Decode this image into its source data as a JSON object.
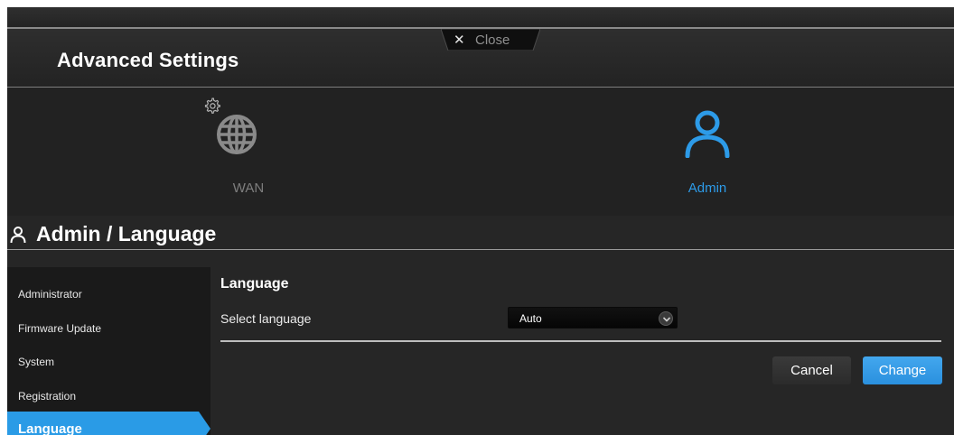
{
  "header": {
    "title": "Advanced Settings",
    "close_label": "Close"
  },
  "nav": {
    "wan_label": "WAN",
    "admin_label": "Admin"
  },
  "section": {
    "title": "Admin / Language"
  },
  "sidebar": {
    "items": [
      {
        "label": "Administrator",
        "active": false
      },
      {
        "label": "Firmware Update",
        "active": false
      },
      {
        "label": "System",
        "active": false
      },
      {
        "label": "Registration",
        "active": false
      },
      {
        "label": "Language",
        "active": true
      }
    ]
  },
  "content": {
    "heading": "Language",
    "select_label": "Select language",
    "select_value": "Auto"
  },
  "buttons": {
    "cancel": "Cancel",
    "change": "Change"
  },
  "colors": {
    "accent": "#2a9be6",
    "background": "#262626",
    "inactive_icon": "#8a8a8a"
  },
  "icons": {
    "wan": "globe-icon",
    "wan_badge": "gear-icon",
    "admin": "user-icon",
    "close": "close-icon",
    "dropdown": "chevron-down-icon"
  }
}
